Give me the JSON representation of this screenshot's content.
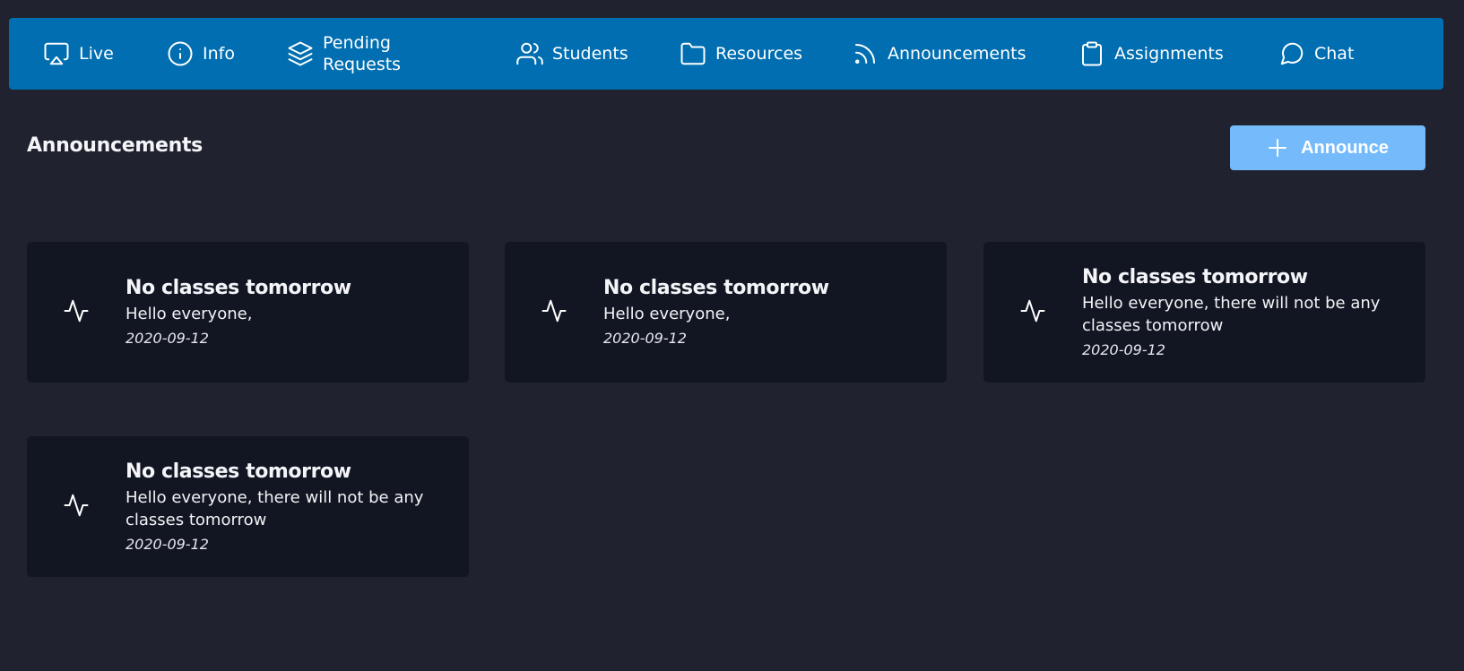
{
  "nav": {
    "items": [
      {
        "label": "Live",
        "icon": "airplay-icon"
      },
      {
        "label": "Info",
        "icon": "info-icon"
      },
      {
        "label": "Pending Requests",
        "icon": "layers-icon"
      },
      {
        "label": "Students",
        "icon": "users-icon"
      },
      {
        "label": "Resources",
        "icon": "folder-icon"
      },
      {
        "label": "Announcements",
        "icon": "rss-icon"
      },
      {
        "label": "Assignments",
        "icon": "clipboard-icon"
      },
      {
        "label": "Chat",
        "icon": "message-circle-icon"
      }
    ]
  },
  "page": {
    "title": "Announcements",
    "announce_button_label": "Announce"
  },
  "announcements": [
    {
      "title": "No classes tomorrow",
      "text": "Hello everyone,",
      "date": "2020-09-12",
      "icon": "activity-icon"
    },
    {
      "title": "No classes tomorrow",
      "text": "Hello everyone,",
      "date": "2020-09-12",
      "icon": "activity-icon"
    },
    {
      "title": "No classes tomorrow",
      "text": "Hello everyone, there will not be any classes tomorrow",
      "date": "2020-09-12",
      "icon": "activity-icon"
    },
    {
      "title": "No classes tomorrow",
      "text": "Hello everyone, there will not be any classes tomorrow",
      "date": "2020-09-12",
      "icon": "activity-icon"
    }
  ],
  "colors": {
    "background": "#20222f",
    "navbar": "#006eb1",
    "card": "#121623",
    "announce_button": "#75bbfb"
  }
}
